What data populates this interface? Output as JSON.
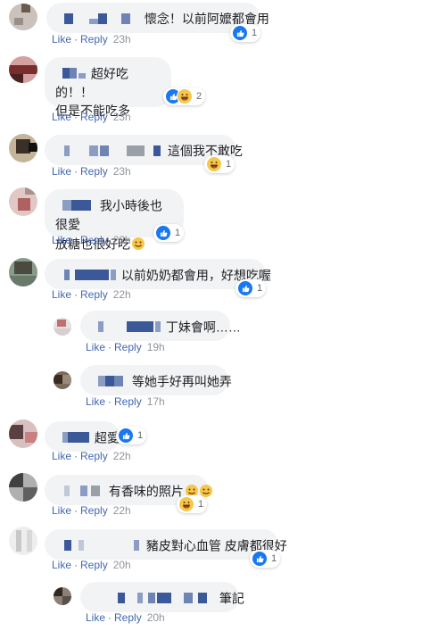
{
  "comments": [
    {
      "text": "懷念！以前阿嬤都會用",
      "like": "Like",
      "reply": "Reply",
      "time": "23h",
      "reaction_count": "1"
    },
    {
      "text1": "超好吃的！！",
      "text2": "但是不能吃多",
      "like": "Like",
      "reply": "Reply",
      "time": "23h",
      "reaction_count": "2"
    },
    {
      "text": "這個我不敢吃",
      "like": "Like",
      "reply": "Reply",
      "time": "23h",
      "reaction_count": "1"
    },
    {
      "text1": "我小時後也很愛",
      "text2": "放糖也很好吃",
      "like": "Like",
      "reply": "Reply",
      "time": "22h",
      "reaction_count": "1"
    },
    {
      "text": "以前奶奶都會用，好想吃喔",
      "like": "Like",
      "reply": "Reply",
      "time": "22h",
      "reaction_count": "1"
    },
    {
      "text": "丁妹會啊……",
      "like": "Like",
      "reply": "Reply",
      "time": "19h"
    },
    {
      "text": "等她手好再叫她弄",
      "like": "Like",
      "reply": "Reply",
      "time": "17h"
    },
    {
      "text": "超愛",
      "like": "Like",
      "reply": "Reply",
      "time": "22h",
      "reaction_count": "1"
    },
    {
      "text": "有香味的照片",
      "like": "Like",
      "reply": "Reply",
      "time": "22h",
      "reaction_count": "1"
    },
    {
      "text": "豬皮對心血管 皮膚都很好",
      "like": "Like",
      "reply": "Reply",
      "time": "20h",
      "reaction_count": "1"
    },
    {
      "text": "筆記",
      "like": "Like",
      "reply": "Reply",
      "time": "20h"
    }
  ],
  "colors": {
    "link": "#4267b2",
    "bubble": "#f2f3f5",
    "meta": "#90949c",
    "like_icon": "#1877f2",
    "haha_icon": "#f7c64a"
  },
  "icons": {
    "like": "thumbs-up-icon",
    "haha": "haha-icon",
    "emoji": "smile-emoji-icon"
  }
}
